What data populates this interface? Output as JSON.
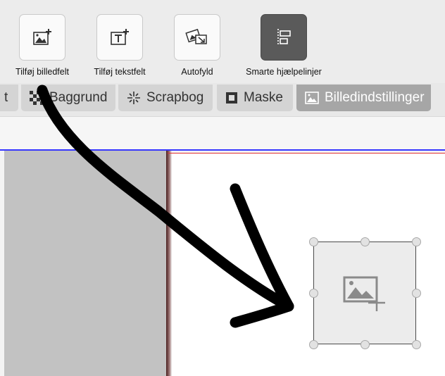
{
  "toolbar": {
    "tools": [
      {
        "label": "Tilføj billedfelt",
        "icon": "add-image-field-icon"
      },
      {
        "label": "Tilføj tekstfelt",
        "icon": "add-text-field-icon"
      },
      {
        "label": "Autofyld",
        "icon": "autofill-icon"
      },
      {
        "label": "Smarte hjælpelinjer",
        "icon": "smart-guides-icon",
        "active": true
      }
    ]
  },
  "tabs": [
    {
      "label": "t",
      "icon": ""
    },
    {
      "label": "Baggrund",
      "icon": "background-checker-icon"
    },
    {
      "label": "Scrapbog",
      "icon": "sparkle-icon"
    },
    {
      "label": "Maske",
      "icon": "mask-icon"
    },
    {
      "label": "Billedindstillinger",
      "icon": "image-settings-icon",
      "active": true
    }
  ],
  "colors": {
    "toolbar_bg": "#ececec",
    "active_tool": "#5a5a5a",
    "active_tab": "#a6a6a6",
    "guide_line": "#3636ff",
    "page_margin": "#e03030",
    "annotation_arrow": "#000000"
  }
}
